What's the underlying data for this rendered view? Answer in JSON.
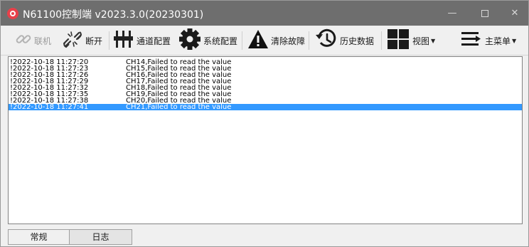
{
  "window": {
    "title": "N61100控制端 v2023.3.0(20230301)",
    "controls": {
      "minimize": "—",
      "close": "✕"
    }
  },
  "toolbar": {
    "items": [
      {
        "label": "联机",
        "icon": "link-icon",
        "enabled": false
      },
      {
        "label": "断开",
        "icon": "broken-link-icon",
        "enabled": true
      },
      {
        "label": "通道配置",
        "icon": "channel-sliders-icon",
        "enabled": true
      },
      {
        "label": "系统配置",
        "icon": "gear-icon",
        "enabled": true
      },
      {
        "label": "清除故障",
        "icon": "warning-icon",
        "enabled": true
      },
      {
        "label": "历史数据",
        "icon": "history-icon",
        "enabled": true
      },
      {
        "label": "视图",
        "icon": "grid-view-icon",
        "enabled": true,
        "dropdown": true
      },
      {
        "label": "主菜单",
        "icon": "menu-icon",
        "enabled": true,
        "dropdown": true
      }
    ]
  },
  "log": {
    "entries": [
      {
        "time": "!2022-10-18 11:27:20",
        "message": "CH14,Failed to read the value"
      },
      {
        "time": "!2022-10-18 11:27:23",
        "message": "CH15,Failed to read the value"
      },
      {
        "time": "!2022-10-18 11:27:26",
        "message": "CH16,Failed to read the value"
      },
      {
        "time": "!2022-10-18 11:27:29",
        "message": "CH17,Failed to read the value"
      },
      {
        "time": "!2022-10-18 11:27:32",
        "message": "CH18,Failed to read the value"
      },
      {
        "time": "!2022-10-18 11:27:35",
        "message": "CH19,Failed to read the value"
      },
      {
        "time": "!2022-10-18 11:27:38",
        "message": "CH20,Failed to read the value"
      },
      {
        "time": "!2022-10-18 11:27:41",
        "message": "CH21,Failed to read the value"
      }
    ],
    "selected_index": 7
  },
  "tabs": [
    {
      "label": "常规",
      "active": false
    },
    {
      "label": "日志",
      "active": true
    }
  ],
  "colors": {
    "titlebar": "#6e6e6e",
    "selection": "#3399ff",
    "app_icon": "#e8404a"
  }
}
